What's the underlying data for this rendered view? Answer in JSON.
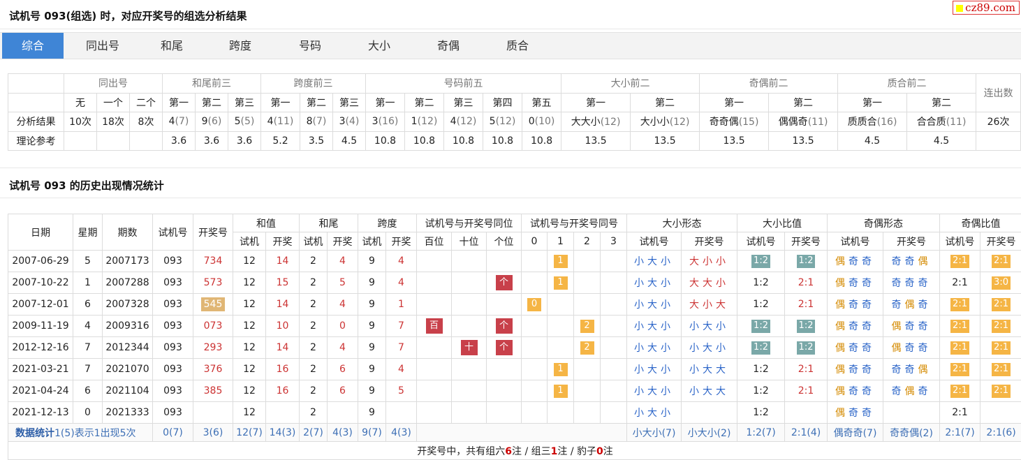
{
  "title1": "试机号 093(组选) 时，对应开奖号的组选分析结果",
  "title2": "试机号 093 的历史出现情况统计",
  "logo": "cz89.com",
  "tabs": [
    "综合",
    "同出号",
    "和尾",
    "跨度",
    "号码",
    "大小",
    "奇偶",
    "质合"
  ],
  "t1": {
    "groups": [
      "同出号",
      "和尾前三",
      "跨度前三",
      "号码前五",
      "大小前二",
      "奇偶前二",
      "质合前二",
      "连出数"
    ],
    "subs": [
      "无",
      "一个",
      "二个",
      "第一",
      "第二",
      "第三",
      "第一",
      "第二",
      "第三",
      "第一",
      "第二",
      "第三",
      "第四",
      "第五",
      "第一",
      "第二",
      "第一",
      "第二",
      "第一",
      "第二"
    ],
    "row1_label": "分析结果",
    "row1": [
      [
        "10次",
        ""
      ],
      [
        "18次",
        ""
      ],
      [
        "8次",
        ""
      ],
      [
        "4",
        "(7)"
      ],
      [
        "9",
        "(6)"
      ],
      [
        "5",
        "(5)"
      ],
      [
        "4",
        "(11)"
      ],
      [
        "8",
        "(7)"
      ],
      [
        "3",
        "(4)"
      ],
      [
        "3",
        "(16)"
      ],
      [
        "1",
        "(12)"
      ],
      [
        "4",
        "(12)"
      ],
      [
        "5",
        "(12)"
      ],
      [
        "0",
        "(10)"
      ],
      [
        "大大小",
        "(12)"
      ],
      [
        "大小小",
        "(12)"
      ],
      [
        "奇奇偶",
        "(15)"
      ],
      [
        "偶偶奇",
        "(11)"
      ],
      [
        "质质合",
        "(16)"
      ],
      [
        "合合质",
        "(11)"
      ],
      [
        "26次",
        ""
      ]
    ],
    "row2_label": "理论参考",
    "row2": [
      "",
      "",
      "",
      "3.6",
      "3.6",
      "3.6",
      "5.2",
      "3.5",
      "4.5",
      "10.8",
      "10.8",
      "10.8",
      "10.8",
      "10.8",
      "13.5",
      "13.5",
      "13.5",
      "13.5",
      "4.5",
      "4.5",
      ""
    ]
  },
  "t2": {
    "h1": [
      "日期",
      "星期",
      "期数",
      "试机号",
      "开奖号",
      "和值",
      "和尾",
      "跨度",
      "试机号与开奖号同位",
      "试机号与开奖号同号",
      "大小形态",
      "大小比值",
      "奇偶形态",
      "奇偶比值"
    ],
    "h2": [
      "试机",
      "开奖",
      "试机",
      "开奖",
      "试机",
      "开奖",
      "百位",
      "十位",
      "个位",
      "0",
      "1",
      "2",
      "3",
      "试机号",
      "开奖号",
      "试机号",
      "开奖号",
      "试机号",
      "开奖号",
      "试机号",
      "开奖号"
    ],
    "rows": [
      {
        "date": "2007-06-29",
        "wk": "5",
        "qi": "2007173",
        "sj": "093",
        "kj": "734",
        "hs": "12",
        "hk": "14",
        "ws": "2",
        "wk2": "4",
        "ks": "9",
        "kk": "4",
        "bai": "",
        "shi": "",
        "ge": "",
        "n0": "",
        "n1": "1",
        "n2": "",
        "n3": "",
        "dxs": "小大小",
        "dxk": "大小小",
        "dbs": "1:2",
        "dbk": "1:2",
        "jos": "偶奇奇",
        "jok": "奇奇偶",
        "jbs": "2:1",
        "jbk": "2:1"
      },
      {
        "date": "2007-10-22",
        "wk": "1",
        "qi": "2007288",
        "sj": "093",
        "kj": "573",
        "hs": "12",
        "hk": "15",
        "ws": "2",
        "wk2": "5",
        "ks": "9",
        "kk": "4",
        "bai": "",
        "shi": "",
        "ge": "个",
        "n0": "",
        "n1": "1",
        "n2": "",
        "n3": "",
        "dxs": "小大小",
        "dxk": "大大小",
        "dbs": "1:2",
        "dbk": "2:1",
        "jos": "偶奇奇",
        "jok": "奇奇奇",
        "jbs": "2:1",
        "jbk": "3:0"
      },
      {
        "date": "2007-12-01",
        "wk": "6",
        "qi": "2007328",
        "sj": "093",
        "kj": "545",
        "hs": "12",
        "hk": "14",
        "ws": "2",
        "wk2": "4",
        "ks": "9",
        "kk": "1",
        "bai": "",
        "shi": "",
        "ge": "",
        "n0": "0",
        "n1": "",
        "n2": "",
        "n3": "",
        "dxs": "小大小",
        "dxk": "大小大",
        "dbs": "1:2",
        "dbk": "2:1",
        "jos": "偶奇奇",
        "jok": "奇偶奇",
        "jbs": "2:1",
        "jbk": "2:1"
      },
      {
        "date": "2009-11-19",
        "wk": "4",
        "qi": "2009316",
        "sj": "093",
        "kj": "073",
        "hs": "12",
        "hk": "10",
        "ws": "2",
        "wk2": "0",
        "ks": "9",
        "kk": "7",
        "bai": "百",
        "shi": "",
        "ge": "个",
        "n0": "",
        "n1": "",
        "n2": "2",
        "n3": "",
        "dxs": "小大小",
        "dxk": "小大小",
        "dbs": "1:2",
        "dbk": "1:2",
        "jos": "偶奇奇",
        "jok": "偶奇奇",
        "jbs": "2:1",
        "jbk": "2:1"
      },
      {
        "date": "2012-12-16",
        "wk": "7",
        "qi": "2012344",
        "sj": "093",
        "kj": "293",
        "hs": "12",
        "hk": "14",
        "ws": "2",
        "wk2": "4",
        "ks": "9",
        "kk": "7",
        "bai": "",
        "shi": "十",
        "ge": "个",
        "n0": "",
        "n1": "",
        "n2": "2",
        "n3": "",
        "dxs": "小大小",
        "dxk": "小大小",
        "dbs": "1:2",
        "dbk": "1:2",
        "jos": "偶奇奇",
        "jok": "偶奇奇",
        "jbs": "2:1",
        "jbk": "2:1"
      },
      {
        "date": "2021-03-21",
        "wk": "7",
        "qi": "2021070",
        "sj": "093",
        "kj": "376",
        "hs": "12",
        "hk": "16",
        "ws": "2",
        "wk2": "6",
        "ks": "9",
        "kk": "4",
        "bai": "",
        "shi": "",
        "ge": "",
        "n0": "",
        "n1": "1",
        "n2": "",
        "n3": "",
        "dxs": "小大小",
        "dxk": "小大大",
        "dbs": "1:2",
        "dbk": "2:1",
        "jos": "偶奇奇",
        "jok": "奇奇偶",
        "jbs": "2:1",
        "jbk": "2:1"
      },
      {
        "date": "2021-04-24",
        "wk": "6",
        "qi": "2021104",
        "sj": "093",
        "kj": "385",
        "hs": "12",
        "hk": "16",
        "ws": "2",
        "wk2": "6",
        "ks": "9",
        "kk": "5",
        "bai": "",
        "shi": "",
        "ge": "",
        "n0": "",
        "n1": "1",
        "n2": "",
        "n3": "",
        "dxs": "小大小",
        "dxk": "小大大",
        "dbs": "1:2",
        "dbk": "2:1",
        "jos": "偶奇奇",
        "jok": "奇偶奇",
        "jbs": "2:1",
        "jbk": "2:1"
      },
      {
        "date": "2021-12-13",
        "wk": "0",
        "qi": "2021333",
        "sj": "093",
        "kj": "",
        "hs": "12",
        "hk": "",
        "ws": "2",
        "wk2": "",
        "ks": "9",
        "kk": "",
        "bai": "",
        "shi": "",
        "ge": "",
        "n0": "",
        "n1": "",
        "n2": "",
        "n3": "",
        "dxs": "小大小",
        "dxk": "",
        "dbs": "1:2",
        "dbk": "",
        "jos": "偶奇奇",
        "jok": "",
        "jbs": "2:1",
        "jbk": ""
      }
    ],
    "stat_label": "数据统计",
    "stat_note": "1(5)表示1出现5次",
    "stat": [
      "0(7)",
      "3(6)",
      "12(7)",
      "14(3)",
      "2(7)",
      "4(3)",
      "9(7)",
      "4(3)",
      "小大小(7)",
      "小大小(2)",
      "1:2(7)",
      "2:1(4)",
      "偶奇奇(7)",
      "奇奇偶(2)",
      "2:1(7)",
      "2:1(6)"
    ],
    "footer": {
      "a": "开奖号中，共有组六",
      "n6": "6",
      "b": "注 / 组三",
      "n3": "1",
      "c": "注 / 豹子",
      "n0": "0",
      "d": "注"
    }
  }
}
